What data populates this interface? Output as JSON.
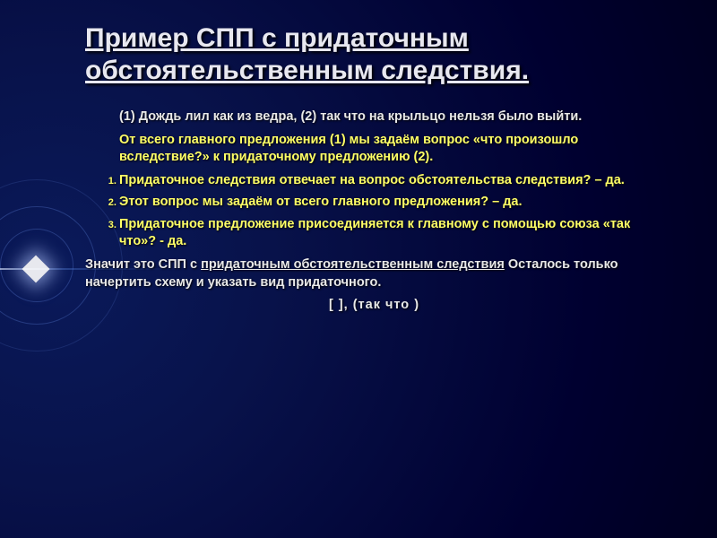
{
  "title": "Пример СПП  с придаточным обстоятельственным следствия.",
  "intro": "(1) Дождь лил как из ведра, (2) так что на крыльцо нельзя было выйти.",
  "para1": "От всего главного предложения (1) мы задаём вопрос «что произошло вследствие?» к придаточному предложению (2).",
  "list": {
    "i1": "Придаточное следствия отвечает на вопрос обстоятельства следствия? – да.",
    "i2": "Этот вопрос мы задаём от всего главного предложения? – да.",
    "i3": "Придаточное предложение присоединяется к главному с помощью союза «так что»? - да."
  },
  "closing_pre": "Значит это СПП с ",
  "closing_u": "придаточным обстоятельственным следствия",
  "closing_post": " Осталось только начертить схему и указать вид придаточного.",
  "schema": "[               ], (так что               )"
}
